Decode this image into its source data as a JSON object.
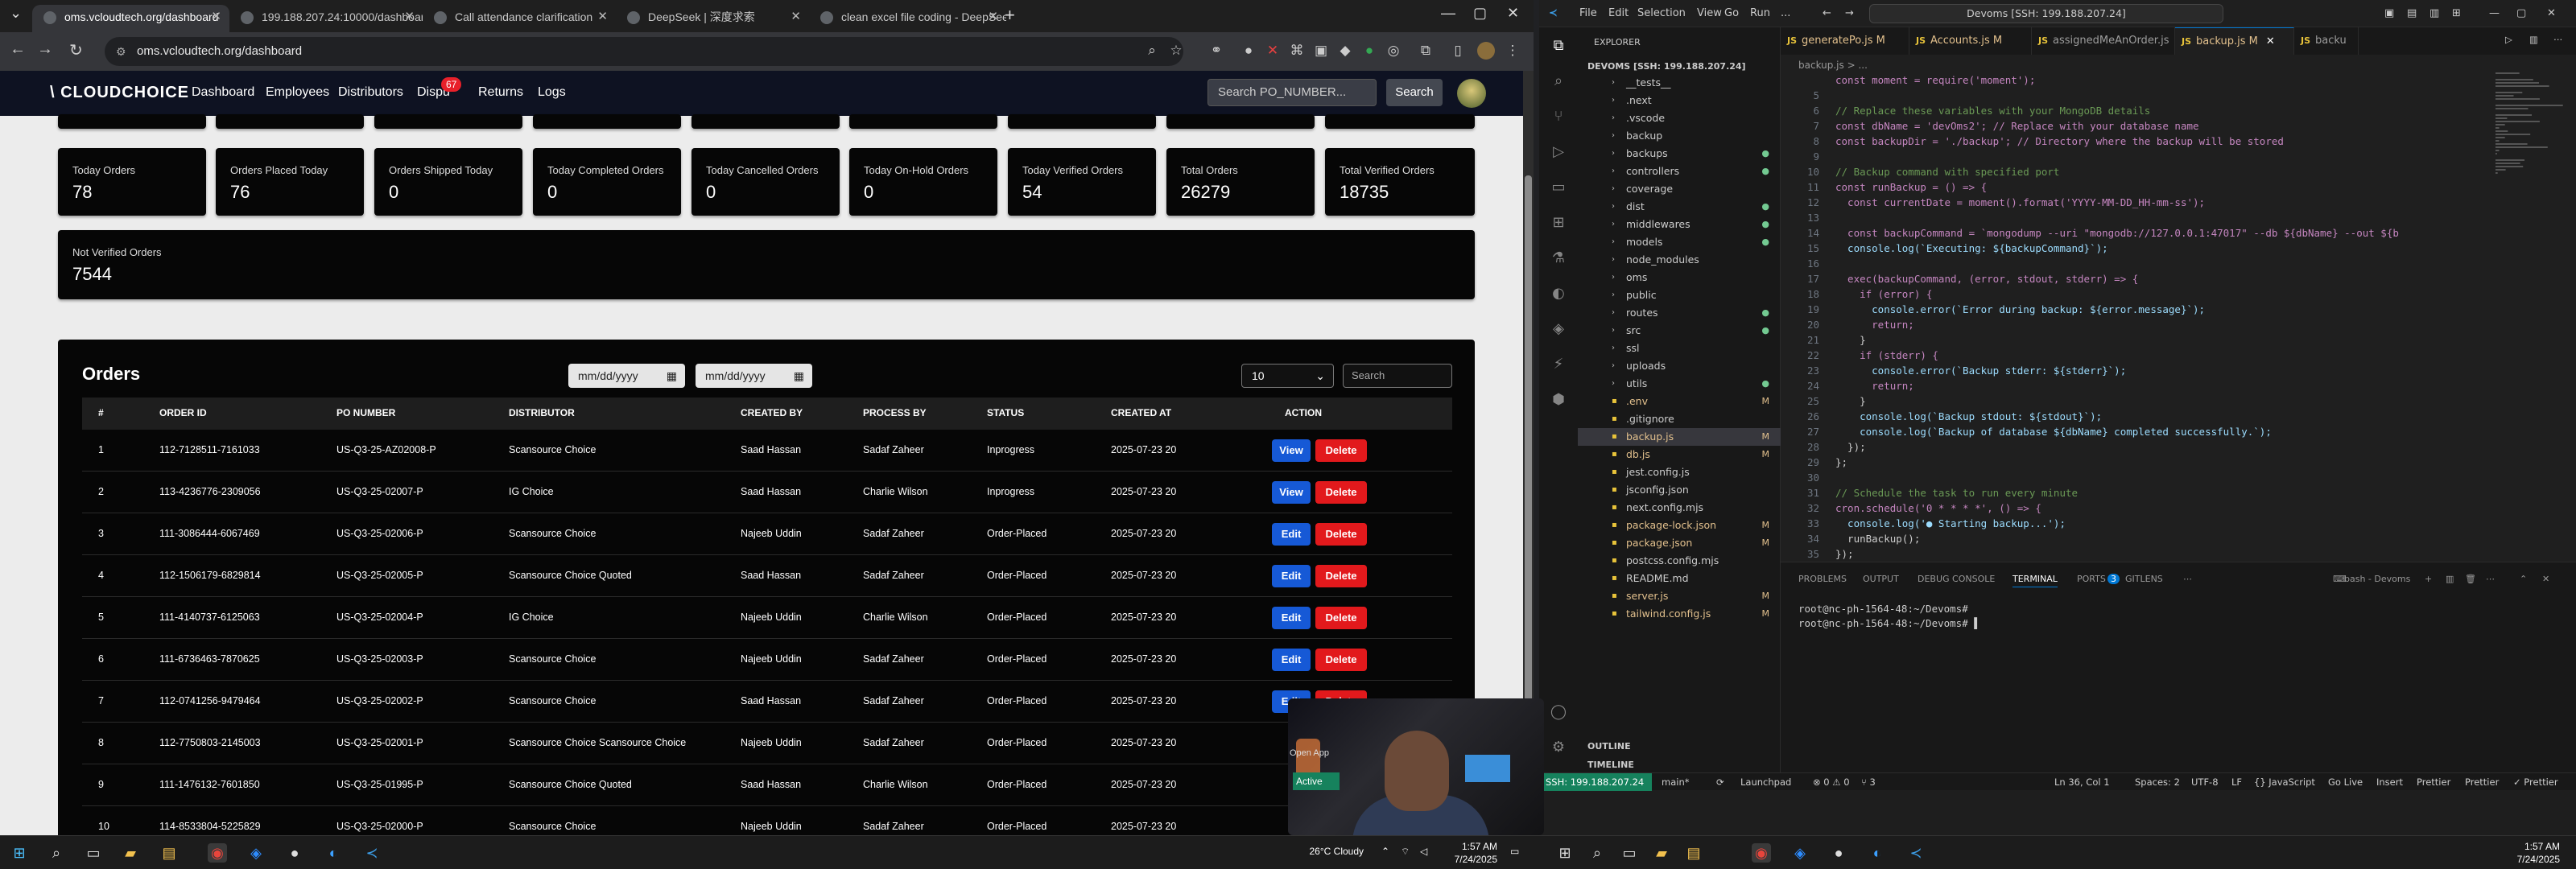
{
  "browser": {
    "tabs": [
      {
        "title": "oms.vcloudtech.org/dashboard",
        "active": true
      },
      {
        "title": "199.188.207.24:10000/dashboard"
      },
      {
        "title": "Call attendance clarification"
      },
      {
        "title": "DeepSeek | 深度求索"
      },
      {
        "title": "clean excel file coding - DeepSeek"
      }
    ],
    "url": "oms.vcloudtech.org/dashboard"
  },
  "app": {
    "logo": "\\ CLOUDCHOICE",
    "nav": [
      "Dashboard",
      "Employees",
      "Distributors",
      "Dispu",
      "Returns",
      "Logs"
    ],
    "dispute_badge": "67",
    "search_placeholder": "Search PO_NUMBER...",
    "search_button": "Search",
    "cards": [
      {
        "label": "Today Orders",
        "value": "78"
      },
      {
        "label": "Orders Placed Today",
        "value": "76"
      },
      {
        "label": "Orders Shipped Today",
        "value": "0"
      },
      {
        "label": "Today Completed Orders",
        "value": "0"
      },
      {
        "label": "Today Cancelled Orders",
        "value": "0"
      },
      {
        "label": "Today On-Hold Orders",
        "value": "0"
      },
      {
        "label": "Today Verified Orders",
        "value": "54"
      },
      {
        "label": "Total Orders",
        "value": "26279"
      },
      {
        "label": "Total Verified Orders",
        "value": "18735"
      }
    ],
    "not_verified": {
      "label": "Not Verified Orders",
      "value": "7544"
    },
    "orders": {
      "title": "Orders",
      "date_from": "mm/dd/yyyy",
      "date_to": "mm/dd/yyyy",
      "page_size": "10",
      "search_placeholder": "Search",
      "columns": [
        "#",
        "ORDER ID",
        "PO NUMBER",
        "DISTRIBUTOR",
        "CREATED BY",
        "PROCESS BY",
        "STATUS",
        "CREATED AT",
        "ACTION"
      ],
      "rows": [
        {
          "n": "1",
          "order_id": "112-7128511-7161033",
          "po": "US-Q3-25-AZ02008-P",
          "distributor": "Scansource Choice",
          "created_by": "Saad Hassan",
          "process_by": "Sadaf Zaheer",
          "status": "Inprogress",
          "created_at": "2025-07-23 20",
          "action": "View"
        },
        {
          "n": "2",
          "order_id": "113-4236776-2309056",
          "po": "US-Q3-25-02007-P",
          "distributor": "IG Choice",
          "created_by": "Saad Hassan",
          "process_by": "Charlie Wilson",
          "status": "Inprogress",
          "created_at": "2025-07-23 20",
          "action": "View"
        },
        {
          "n": "3",
          "order_id": "111-3086444-6067469",
          "po": "US-Q3-25-02006-P",
          "distributor": "Scansource Choice",
          "created_by": "Najeeb Uddin",
          "process_by": "Sadaf Zaheer",
          "status": "Order-Placed",
          "created_at": "2025-07-23 20",
          "action": "Edit"
        },
        {
          "n": "4",
          "order_id": "112-1506179-6829814",
          "po": "US-Q3-25-02005-P",
          "distributor": "Scansource Choice Quoted",
          "created_by": "Saad Hassan",
          "process_by": "Sadaf Zaheer",
          "status": "Order-Placed",
          "created_at": "2025-07-23 20",
          "action": "Edit"
        },
        {
          "n": "5",
          "order_id": "111-4140737-6125063",
          "po": "US-Q3-25-02004-P",
          "distributor": "IG Choice",
          "created_by": "Najeeb Uddin",
          "process_by": "Charlie Wilson",
          "status": "Order-Placed",
          "created_at": "2025-07-23 20",
          "action": "Edit"
        },
        {
          "n": "6",
          "order_id": "111-6736463-7870625",
          "po": "US-Q3-25-02003-P",
          "distributor": "Scansource Choice",
          "created_by": "Najeeb Uddin",
          "process_by": "Sadaf Zaheer",
          "status": "Order-Placed",
          "created_at": "2025-07-23 20",
          "action": "Edit"
        },
        {
          "n": "7",
          "order_id": "112-0741256-9479464",
          "po": "US-Q3-25-02002-P",
          "distributor": "Scansource Choice",
          "created_by": "Saad Hassan",
          "process_by": "Sadaf Zaheer",
          "status": "Order-Placed",
          "created_at": "2025-07-23 20",
          "action": "Edit"
        },
        {
          "n": "8",
          "order_id": "112-7750803-2145003",
          "po": "US-Q3-25-02001-P",
          "distributor": "Scansource Choice Scansource Choice",
          "created_by": "Najeeb Uddin",
          "process_by": "Sadaf Zaheer",
          "status": "Order-Placed",
          "created_at": "2025-07-23 20",
          "action": ""
        },
        {
          "n": "9",
          "order_id": "111-1476132-7601850",
          "po": "US-Q3-25-01995-P",
          "distributor": "Scansource Choice Quoted",
          "created_by": "Saad Hassan",
          "process_by": "Charlie Wilson",
          "status": "Order-Placed",
          "created_at": "2025-07-23 20",
          "action": ""
        },
        {
          "n": "10",
          "order_id": "114-8533804-5225829",
          "po": "US-Q3-25-02000-P",
          "distributor": "Scansource Choice",
          "created_by": "Najeeb Uddin",
          "process_by": "Sadaf Zaheer",
          "status": "Order-Placed",
          "created_at": "2025-07-23 20",
          "action": ""
        }
      ],
      "delete_label": "Delete"
    }
  },
  "vscode": {
    "menu": [
      "File",
      "Edit",
      "Selection",
      "View",
      "Go",
      "Run",
      "..."
    ],
    "command_center": "Devoms [SSH: 199.188.207.24]",
    "explorer_title": "EXPLORER",
    "workspace": "DEVOMS [SSH: 199.188.207.24]",
    "files": [
      {
        "name": "__tests__",
        "folder": true
      },
      {
        "name": ".next",
        "folder": true
      },
      {
        "name": ".vscode",
        "folder": true
      },
      {
        "name": "backup",
        "folder": true
      },
      {
        "name": "backups",
        "folder": true,
        "dot": true
      },
      {
        "name": "controllers",
        "folder": true,
        "dot": true
      },
      {
        "name": "coverage",
        "folder": true
      },
      {
        "name": "dist",
        "folder": true,
        "dot": true
      },
      {
        "name": "middlewares",
        "folder": true,
        "dot": true
      },
      {
        "name": "models",
        "folder": true,
        "dot": true
      },
      {
        "name": "node_modules",
        "folder": true
      },
      {
        "name": "oms",
        "folder": true
      },
      {
        "name": "public",
        "folder": true
      },
      {
        "name": "routes",
        "folder": true,
        "dot": true
      },
      {
        "name": "src",
        "folder": true,
        "dot": true
      },
      {
        "name": "ssl",
        "folder": true
      },
      {
        "name": "uploads",
        "folder": true
      },
      {
        "name": "utils",
        "folder": true,
        "dot": true
      },
      {
        "name": ".env",
        "status": "M"
      },
      {
        "name": ".gitignore"
      },
      {
        "name": "backup.js",
        "status": "M",
        "selected": true
      },
      {
        "name": "db.js",
        "status": "M"
      },
      {
        "name": "jest.config.js"
      },
      {
        "name": "jsconfig.json"
      },
      {
        "name": "next.config.mjs"
      },
      {
        "name": "package-lock.json",
        "status": "M"
      },
      {
        "name": "package.json",
        "status": "M"
      },
      {
        "name": "postcss.config.mjs"
      },
      {
        "name": "README.md"
      },
      {
        "name": "server.js",
        "status": "M"
      },
      {
        "name": "tailwind.config.js",
        "status": "M"
      }
    ],
    "outline": "OUTLINE",
    "timeline": "TIMELINE",
    "editor_tabs": [
      {
        "name": "generatePo.js",
        "status": "M"
      },
      {
        "name": "Accounts.js",
        "status": "M"
      },
      {
        "name": "assignedMeAnOrder.js"
      },
      {
        "name": "backup.js",
        "status": "M",
        "active": true
      },
      {
        "name": "backu"
      }
    ],
    "breadcrumb": "backup.js > ...",
    "code": [
      {
        "n": "",
        "t": "const moment = require('moment');"
      },
      {
        "n": "5",
        "t": ""
      },
      {
        "n": "6",
        "t": "// Replace these variables with your MongoDB details"
      },
      {
        "n": "7",
        "t": "const dbName = 'devOms2'; // Replace with your database name"
      },
      {
        "n": "8",
        "t": "const backupDir = './backup'; // Directory where the backup will be stored"
      },
      {
        "n": "9",
        "t": ""
      },
      {
        "n": "10",
        "t": "// Backup command with specified port"
      },
      {
        "n": "11",
        "t": "const runBackup = () => {"
      },
      {
        "n": "12",
        "t": "  const currentDate = moment().format('YYYY-MM-DD_HH-mm-ss');"
      },
      {
        "n": "13",
        "t": ""
      },
      {
        "n": "14",
        "t": "  const backupCommand = `mongodump --uri \"mongodb://127.0.0.1:47017\" --db ${dbName} --out ${b"
      },
      {
        "n": "15",
        "t": "  console.log(`Executing: ${backupCommand}`);"
      },
      {
        "n": "16",
        "t": ""
      },
      {
        "n": "17",
        "t": "  exec(backupCommand, (error, stdout, stderr) => {"
      },
      {
        "n": "18",
        "t": "    if (error) {"
      },
      {
        "n": "19",
        "t": "      console.error(`Error during backup: ${error.message}`);"
      },
      {
        "n": "20",
        "t": "      return;"
      },
      {
        "n": "21",
        "t": "    }"
      },
      {
        "n": "22",
        "t": "    if (stderr) {"
      },
      {
        "n": "23",
        "t": "      console.error(`Backup stderr: ${stderr}`);"
      },
      {
        "n": "24",
        "t": "      return;"
      },
      {
        "n": "25",
        "t": "    }"
      },
      {
        "n": "26",
        "t": "    console.log(`Backup stdout: ${stdout}`);"
      },
      {
        "n": "27",
        "t": "    console.log(`Backup of database ${dbName} completed successfully.`);"
      },
      {
        "n": "28",
        "t": "  });"
      },
      {
        "n": "29",
        "t": "};"
      },
      {
        "n": "30",
        "t": ""
      },
      {
        "n": "31",
        "t": "// Schedule the task to run every minute"
      },
      {
        "n": "32",
        "t": "cron.schedule('0 * * * *', () => {"
      },
      {
        "n": "33",
        "t": "  console.log('● Starting backup...');"
      },
      {
        "n": "34",
        "t": "  runBackup();"
      },
      {
        "n": "35",
        "t": "});"
      }
    ],
    "panel_tabs": [
      "PROBLEMS",
      "OUTPUT",
      "DEBUG CONSOLE",
      "TERMINAL",
      "PORTS",
      "GITLENS"
    ],
    "ports_badge": "3",
    "terminal_name": "bash - Devoms",
    "terminal": [
      "root@nc-ph-1564-48:~/Devoms#",
      "root@nc-ph-1564-48:~/Devoms# ▌"
    ],
    "status": {
      "remote": "SSH: 199.188.207.24",
      "branch": "main*",
      "launchpad": "Launchpad",
      "problems": "⊗ 0 ⚠ 0",
      "ports": "⑂ 3",
      "position": "Ln 36, Col 1",
      "spaces": "Spaces: 2",
      "encoding": "UTF-8",
      "eol": "LF",
      "language": "{} JavaScript",
      "golive": "Go Live",
      "insert": "Insert",
      "prettier1": "Prettier",
      "prettier2": "Prettier",
      "prettier3": "✓ Prettier"
    },
    "share_label": "Open App",
    "session_label": "Active"
  },
  "taskbar": {
    "weather": "26°C  Cloudy",
    "time_left": "1:57 AM",
    "date_left": "7/24/2025",
    "time_right": "1:57 AM",
    "date_right": "7/24/2025"
  }
}
